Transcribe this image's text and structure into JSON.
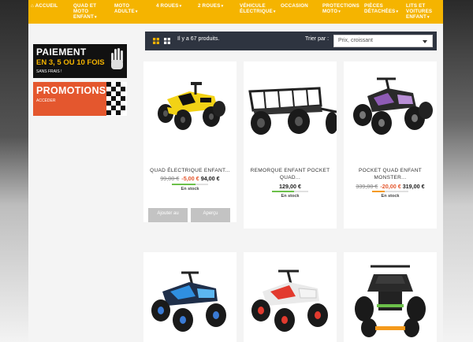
{
  "nav": {
    "items": [
      {
        "label": "Accueil",
        "icon": "home-icon",
        "caret": false
      },
      {
        "label": "Quad et moto enfant",
        "caret": true
      },
      {
        "label": "Moto adulte",
        "caret": true
      },
      {
        "label": "4 roues",
        "caret": true
      },
      {
        "label": "2 roues",
        "caret": true
      },
      {
        "label": "Véhicule électrique",
        "caret": true
      },
      {
        "label": "Occasion",
        "caret": false
      },
      {
        "label": "Protections moto",
        "caret": true
      },
      {
        "label": "Pièces détachées",
        "caret": true
      },
      {
        "label": "Lits et voitures enfant",
        "caret": true
      }
    ]
  },
  "sidebar": {
    "payment_banner": {
      "title": "PAIEMENT",
      "subtitle": "EN 3, 5 OU 10 FOIS",
      "note": "SANS FRAIS !"
    },
    "promo_banner": {
      "title": "PROMOTIONS",
      "note": "ACCÉDER"
    }
  },
  "toolbar": {
    "count": "Il y a 67 produits.",
    "sort_label": "Trier par :",
    "sort_value": "Prix, croissant"
  },
  "colors": {
    "accent": "#f5b400",
    "promo": "#e4572e",
    "toolbar": "#2e3440"
  },
  "products": [
    {
      "name": "QUAD ÉLECTRIQUE ENFANT...",
      "old_price": "99,00 €",
      "discount": "-5,00 €",
      "price": "94,00 €",
      "stock": "En stock",
      "stock_level": 0.65,
      "stock_color": "#6cc04a",
      "buttons": [
        "Ajouter au",
        "Aperçu"
      ]
    },
    {
      "name": "REMORQUE ENFANT POCKET QUAD...",
      "old_price": "",
      "discount": "",
      "price": "129,00 €",
      "stock": "En stock",
      "stock_level": 0.6,
      "stock_color": "#6cc04a"
    },
    {
      "name": "POCKET QUAD ENFANT MONSTER...",
      "old_price": "339,00 €",
      "discount": "-20,00 €",
      "price": "319,00 €",
      "stock": "En stock",
      "stock_level": 0.35,
      "stock_color": "#f59a1b"
    }
  ]
}
